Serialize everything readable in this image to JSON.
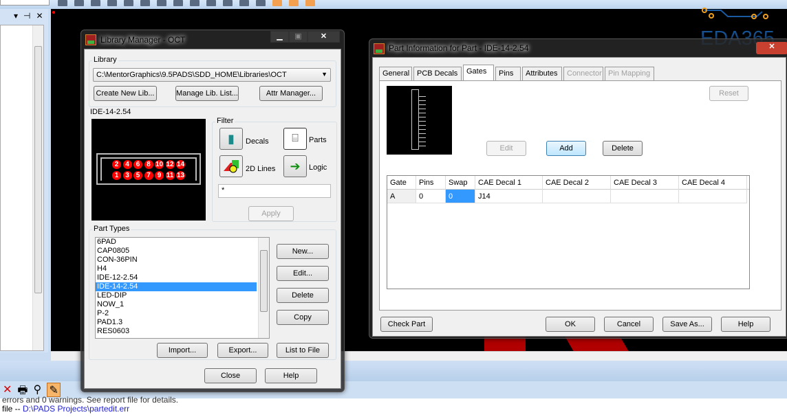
{
  "app": {
    "top_toolbar_icons": [
      "list-icon",
      "route-icon",
      "component-icon",
      "net-icon",
      "board-icon",
      "via-icon",
      "bug-icon",
      "line-icon",
      "dim-icon",
      "zoom-icon",
      "zoom-area-icon",
      "redo-icon",
      "highlight-icon",
      "mode-1-icon",
      "mode-2-icon",
      "mode-3-icon"
    ],
    "left_panel": {
      "controls": [
        "▾",
        "⊣",
        "✕"
      ]
    },
    "output": {
      "line1": "errors and 0 warnings. See report file for details.",
      "line2_prefix": "file -- ",
      "line2_link": "D:\\PADS Projects\\partedit.err"
    },
    "watermark": "EDA365"
  },
  "library_manager": {
    "title": "Library Manager - OCT",
    "library_label": "Library",
    "library_path": "C:\\MentorGraphics\\9.5PADS\\SDD_HOME\\Libraries\\OCT",
    "buttons": {
      "create": "Create New Lib...",
      "manage": "Manage Lib. List...",
      "attr": "Attr Manager...",
      "apply": "Apply",
      "new": "New...",
      "edit": "Edit...",
      "delete": "Delete",
      "copy": "Copy",
      "import": "Import...",
      "export": "Export...",
      "list": "List to File",
      "close": "Close",
      "help": "Help"
    },
    "preview_label": "IDE-14-2.54",
    "pins_top": [
      "2",
      "4",
      "6",
      "8",
      "10",
      "12",
      "14"
    ],
    "pins_bottom": [
      "1",
      "3",
      "5",
      "7",
      "9",
      "11",
      "13"
    ],
    "filter": {
      "label": "Filter",
      "decals": "Decals",
      "parts": "Parts",
      "lines": "2D Lines",
      "logic": "Logic",
      "text": "*"
    },
    "part_types_label": "Part Types",
    "part_types": [
      "6PAD",
      "CAP0805",
      "CON-36PIN",
      "H4",
      "IDE-12-2.54",
      "IDE-14-2.54",
      "LED-DIP",
      "NOW_1",
      "P-2",
      "PAD1.3",
      "RES0603"
    ],
    "selected": "IDE-14-2.54"
  },
  "part_info": {
    "title": "Part Information for Part - IDE-14-2.54",
    "tabs": [
      {
        "label": "General",
        "state": "normal"
      },
      {
        "label": "PCB Decals",
        "state": "normal"
      },
      {
        "label": "Gates",
        "state": "active"
      },
      {
        "label": "Pins",
        "state": "normal"
      },
      {
        "label": "Attributes",
        "state": "normal"
      },
      {
        "label": "Connector",
        "state": "disabled"
      },
      {
        "label": "Pin Mapping",
        "state": "disabled"
      }
    ],
    "buttons": {
      "reset": "Reset",
      "edit": "Edit",
      "add": "Add",
      "delete": "Delete",
      "check": "Check Part",
      "ok": "OK",
      "cancel": "Cancel",
      "save": "Save As...",
      "help": "Help"
    },
    "columns": [
      "Gate",
      "Pins",
      "Swap",
      "CAE Decal 1",
      "CAE Decal 2",
      "CAE Decal 3",
      "CAE Decal 4"
    ],
    "rows": [
      [
        "A",
        "0",
        "0",
        "J14",
        "",
        "",
        ""
      ]
    ]
  },
  "colors": {
    "accent": "#3399ff",
    "pad": "#ff0000",
    "canvas": "#000000"
  }
}
